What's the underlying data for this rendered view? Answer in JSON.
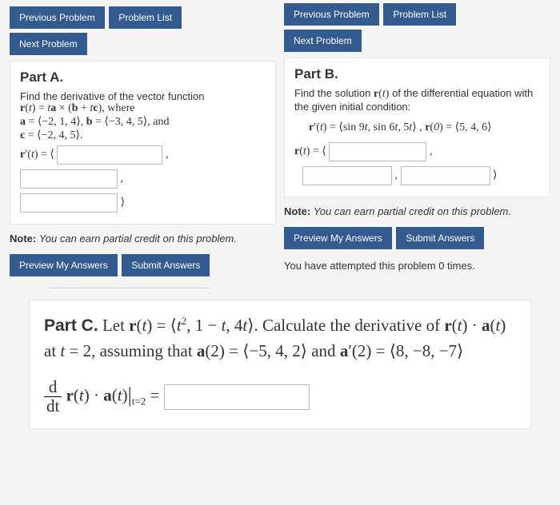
{
  "nav": {
    "prev": "Previous Problem",
    "list": "Problem List",
    "next": "Next Problem"
  },
  "partA": {
    "title": "Part A.",
    "line1": "Find the derivative of the vector function",
    "eq1": "r(t) = ta × (b + tc), where",
    "eq2": "a = ⟨−2, 1, 4⟩, b = ⟨−3, 4, 5⟩, and",
    "eq3": "c = ⟨−2, 4, 5⟩.",
    "rprime": "r′(t) = ⟨",
    "comma": ",",
    "close": "⟩",
    "note_b": "Note:",
    "note_i": "You can earn partial credit on this problem."
  },
  "partB": {
    "title": "Part B.",
    "line1": "Find the solution r(t) of the differential equation with the given initial condition:",
    "eq1": "r′(t) = ⟨sin 9t, sin 6t, 5t⟩ , r(0) = ⟨5, 4, 6⟩",
    "rt": "r(t) = ⟨",
    "comma": ",",
    "close": "⟩",
    "note_b": "Note:",
    "note_i": "You can earn partial credit on this problem.",
    "attempted": "You have attempted this problem 0 times."
  },
  "partC": {
    "title": "Part C.",
    "body1": " Let r(t) = ⟨t",
    "body1b": ", 1 − t, 4t⟩. Calculate the derivative of r(t) · a(t) at t = 2, assuming that a(2) = ⟨−5, 4, 2⟩ and a′(2) = ⟨8, −8, −7⟩",
    "frac_num": "d",
    "frac_den": "dt",
    "eq_tail": "r(t) · a(t)",
    "eval": "t=2",
    "equals": " = "
  },
  "buttons": {
    "preview": "Preview My Answers",
    "submit": "Submit Answers"
  }
}
